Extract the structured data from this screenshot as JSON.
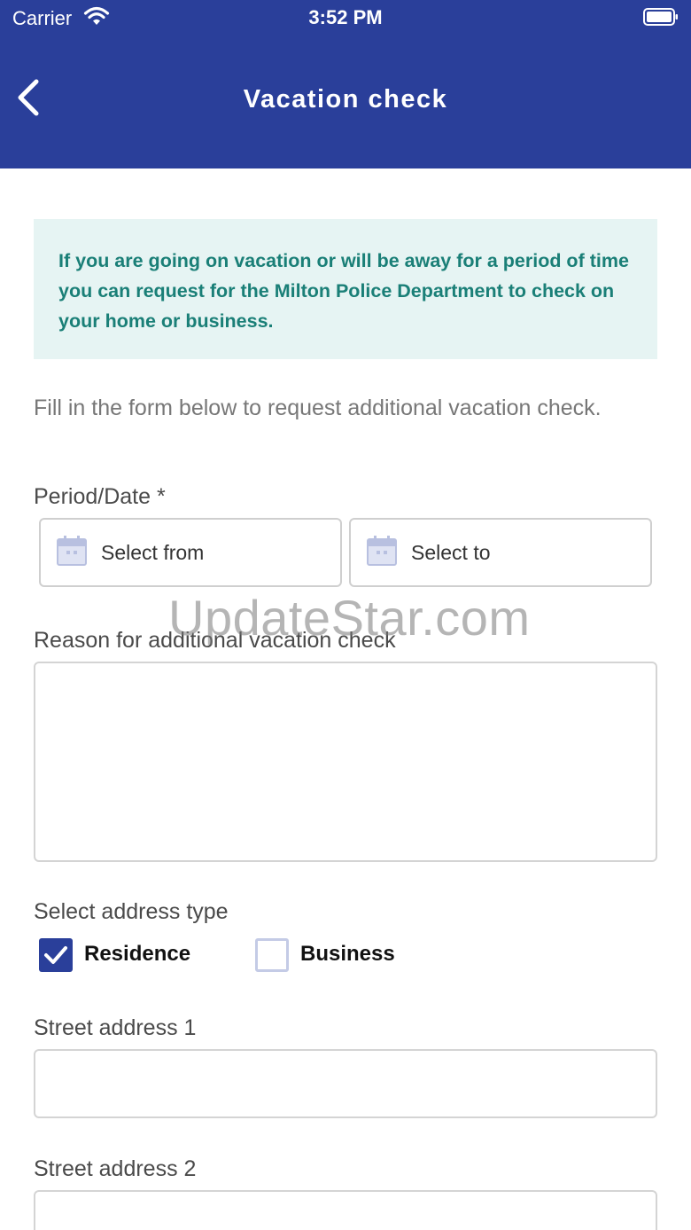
{
  "status_bar": {
    "carrier": "Carrier",
    "time": "3:52 PM"
  },
  "header": {
    "title": "Vacation check"
  },
  "info": {
    "text": "If you are going on vacation or will be away for a period of time you can request for the Milton Police Department to check on your home or business."
  },
  "intro": "Fill in the form below to request additional vacation check.",
  "period": {
    "label": "Period/Date *",
    "from_placeholder": "Select from",
    "to_placeholder": "Select to"
  },
  "reason": {
    "label": "Reason for additional vacation check",
    "value": ""
  },
  "address_type": {
    "label": "Select address type",
    "options": [
      {
        "label": "Residence",
        "checked": true
      },
      {
        "label": "Business",
        "checked": false
      }
    ]
  },
  "street1": {
    "label": "Street address 1",
    "value": ""
  },
  "street2": {
    "label": "Street address 2",
    "value": ""
  },
  "watermark": "UpdateStar.com",
  "colors": {
    "primary": "#2a3f9a",
    "info_bg": "#e6f4f3",
    "info_text": "#1a7f77"
  }
}
